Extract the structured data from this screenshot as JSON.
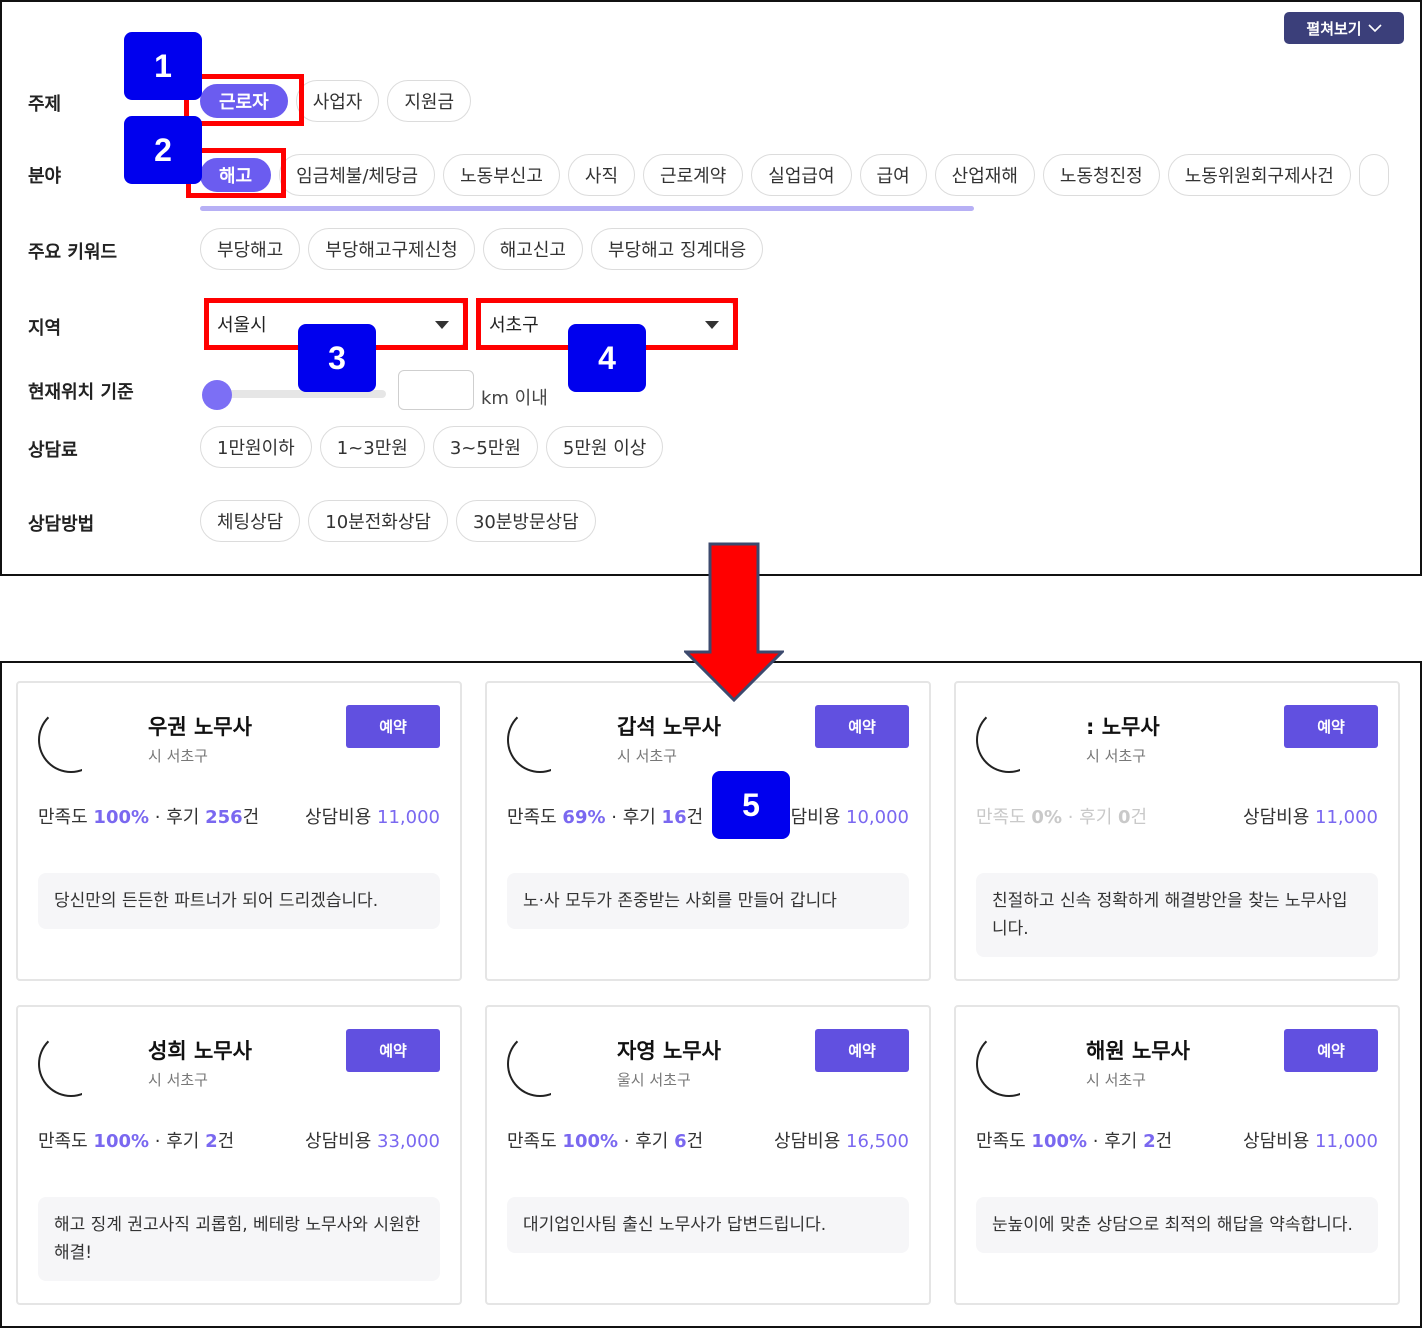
{
  "filters": {
    "expand_label": "펼쳐보기",
    "topic": {
      "label": "주제",
      "chips": [
        "근로자",
        "사업자",
        "지원금"
      ],
      "selected": "근로자"
    },
    "field": {
      "label": "분야",
      "chips": [
        "해고",
        "임금체불/체당금",
        "노동부신고",
        "사직",
        "근로계약",
        "실업급여",
        "급여",
        "산업재해",
        "노동청진정",
        "노동위원회구제사건"
      ],
      "selected": "해고"
    },
    "keywords": {
      "label": "주요 키워드",
      "chips": [
        "부당해고",
        "부당해고구제신청",
        "해고신고",
        "부당해고 징계대응"
      ]
    },
    "region": {
      "label": "지역",
      "city": "서울시",
      "district": "서초구"
    },
    "location": {
      "label": "현재위치 기준",
      "unit_text": "km 이내",
      "slider_fraction": 0
    },
    "fee": {
      "label": "상담료",
      "chips": [
        "1만원이하",
        "1~3만원",
        "3~5만원",
        "5만원 이상"
      ]
    },
    "method": {
      "label": "상담방법",
      "chips": [
        "체팅상담",
        "10분전화상담",
        "30분방문상담"
      ]
    }
  },
  "annotations": [
    "1",
    "2",
    "3",
    "4",
    "5"
  ],
  "cards": [
    {
      "name": "우권 노무사",
      "region": "시 서초구",
      "satisfaction_label": "만족도",
      "satisfaction": "100%",
      "reviews_label": "후기",
      "reviews": "256",
      "reviews_unit": "건",
      "price_label": "상담비용",
      "price": "11,000",
      "book": "예약",
      "bio": "당신만의 든든한 파트너가 되어 드리겠습니다."
    },
    {
      "name": "갑석 노무사",
      "region": "시 서초구",
      "satisfaction_label": "만족도",
      "satisfaction": "69%",
      "reviews_label": "후기",
      "reviews": "16",
      "reviews_unit": "건",
      "price_label": "상담비용",
      "price": "10,000",
      "book": "예약",
      "bio": "노·사 모두가 존중받는 사회를 만들어 갑니다"
    },
    {
      "name": ": 노무사",
      "region": "시 서초구",
      "satisfaction_label": "만족도",
      "satisfaction": "0%",
      "reviews_label": "후기",
      "reviews": "0",
      "reviews_unit": "건",
      "price_label": "상담비용",
      "price": "11,000",
      "book": "예약",
      "bio": "친절하고 신속 정확하게 해결방안을 찾는 노무사입니다."
    },
    {
      "name": "성희 노무사",
      "region": "시 서초구",
      "satisfaction_label": "만족도",
      "satisfaction": "100%",
      "reviews_label": "후기",
      "reviews": "2",
      "reviews_unit": "건",
      "price_label": "상담비용",
      "price": "33,000",
      "book": "예약",
      "bio": "해고 징계 권고사직 괴롭힘, 베테랑 노무사와 시원한 해결!"
    },
    {
      "name": "자영 노무사",
      "region": "울시 서초구",
      "satisfaction_label": "만족도",
      "satisfaction": "100%",
      "reviews_label": "후기",
      "reviews": "6",
      "reviews_unit": "건",
      "price_label": "상담비용",
      "price": "16,500",
      "book": "예약",
      "bio": "대기업인사팀 출신 노무사가 답변드립니다."
    },
    {
      "name": "해원 노무사",
      "region": "시 서초구",
      "satisfaction_label": "만족도",
      "satisfaction": "100%",
      "reviews_label": "후기",
      "reviews": "2",
      "reviews_unit": "건",
      "price_label": "상담비용",
      "price": "11,000",
      "book": "예약",
      "bio": "눈높이에 맞춘 상담으로 최적의 해답을 약속합니다."
    }
  ],
  "colors": {
    "accent": "#6150e0",
    "highlight": "#7a68f0",
    "annotation_box": "#ff0000",
    "annotation_badge": "#0000ee",
    "expand_btn": "#3b3f7a"
  }
}
